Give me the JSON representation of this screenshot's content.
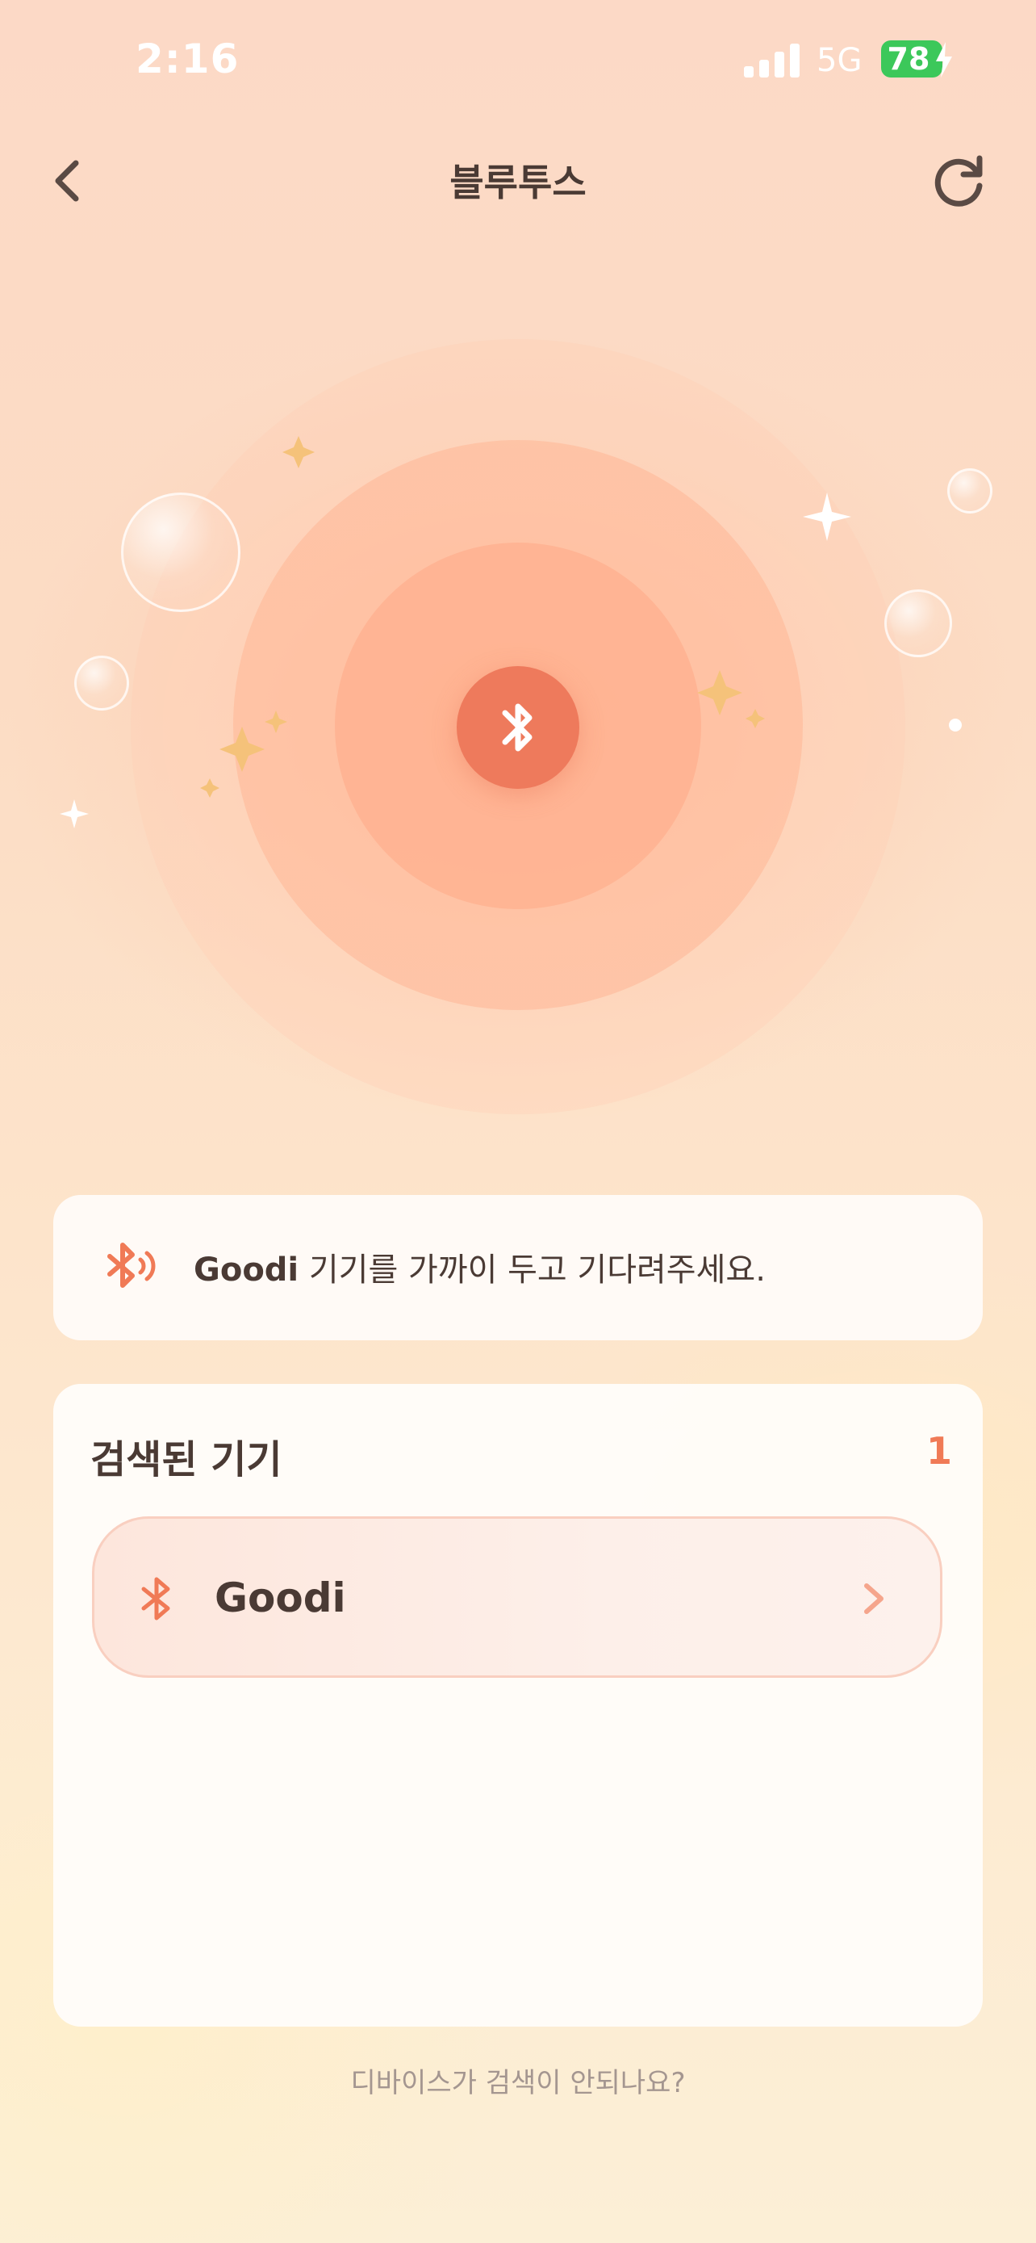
{
  "status_bar": {
    "time": "2:16",
    "network": "5G",
    "battery": "78"
  },
  "header": {
    "title": "블루투스",
    "back_icon": "chevron-left-icon",
    "refresh_icon": "refresh-icon"
  },
  "scanner": {
    "center_icon": "bluetooth-icon",
    "accent_color": "#ee7a5c"
  },
  "info": {
    "brand": "Goodi",
    "message": " 기기를 가까이 두고 기다려주세요.",
    "icon": "bluetooth-searching-icon"
  },
  "device_list": {
    "title": "검색된 기기",
    "count": "1",
    "devices": [
      {
        "name": "Goodi",
        "icon": "bluetooth-icon"
      }
    ]
  },
  "help_link": "디바이스가 검색이 안되나요?"
}
